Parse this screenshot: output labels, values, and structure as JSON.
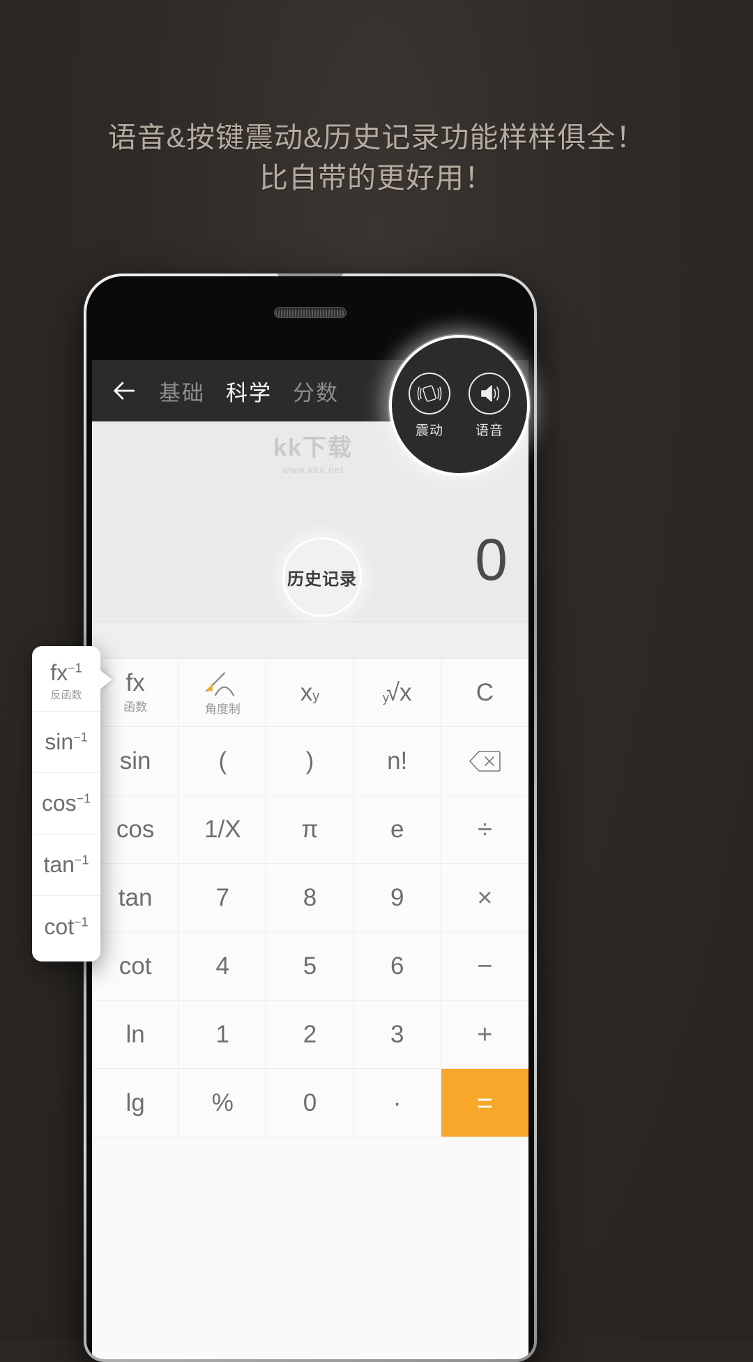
{
  "headline": {
    "line1": "语音&按键震动&历史记录功能样样俱全！",
    "line2": "比自带的更好用！"
  },
  "app": {
    "appbar": {
      "back_icon": "back-arrow-icon",
      "tabs": [
        {
          "label": "基础",
          "active": false
        },
        {
          "label": "科学",
          "active": true
        },
        {
          "label": "分数",
          "active": false
        }
      ]
    },
    "display": {
      "value": "0",
      "watermark_main": "kk下载",
      "watermark_sub": "www.kkx.net"
    },
    "keypad": {
      "rows": [
        [
          {
            "main": "fx",
            "sub": "函数",
            "type": "func"
          },
          {
            "main": "",
            "sub": "角度制",
            "type": "angle-icon"
          },
          {
            "main": "x",
            "sup": "y",
            "type": "power"
          },
          {
            "main": "√x",
            "idx": "y",
            "type": "root"
          },
          {
            "main": "C",
            "type": "clear"
          }
        ],
        [
          {
            "main": "sin",
            "type": "func"
          },
          {
            "main": "(",
            "type": "paren"
          },
          {
            "main": ")",
            "type": "paren"
          },
          {
            "main": "n!",
            "type": "func"
          },
          {
            "main": "",
            "type": "backspace-icon"
          }
        ],
        [
          {
            "main": "cos",
            "type": "func"
          },
          {
            "main": "1/X",
            "type": "func"
          },
          {
            "main": "π",
            "type": "const"
          },
          {
            "main": "e",
            "type": "const"
          },
          {
            "main": "÷",
            "type": "op"
          }
        ],
        [
          {
            "main": "tan",
            "type": "func"
          },
          {
            "main": "7",
            "type": "digit"
          },
          {
            "main": "8",
            "type": "digit"
          },
          {
            "main": "9",
            "type": "digit"
          },
          {
            "main": "×",
            "type": "op"
          }
        ],
        [
          {
            "main": "cot",
            "type": "func"
          },
          {
            "main": "4",
            "type": "digit"
          },
          {
            "main": "5",
            "type": "digit"
          },
          {
            "main": "6",
            "type": "digit"
          },
          {
            "main": "−",
            "type": "op"
          }
        ],
        [
          {
            "main": "ln",
            "type": "func"
          },
          {
            "main": "1",
            "type": "digit"
          },
          {
            "main": "2",
            "type": "digit"
          },
          {
            "main": "3",
            "type": "digit"
          },
          {
            "main": "+",
            "type": "op"
          }
        ],
        [
          {
            "main": "lg",
            "type": "func"
          },
          {
            "main": "%",
            "type": "func"
          },
          {
            "main": "0",
            "type": "digit"
          },
          {
            "main": "·",
            "type": "digit"
          },
          {
            "main": "=",
            "type": "equals"
          }
        ]
      ]
    }
  },
  "magnifier_top": {
    "items": [
      {
        "icon": "vibration-icon",
        "label": "震动"
      },
      {
        "icon": "speaker-icon",
        "label": "语音"
      }
    ]
  },
  "magnifier_history": {
    "label": "历史记录"
  },
  "inverse_panel": {
    "items": [
      {
        "main": "fx",
        "sup": "−1",
        "sub": "反函数"
      },
      {
        "main": "sin",
        "sup": "−1",
        "sub": ""
      },
      {
        "main": "cos",
        "sup": "−1",
        "sub": ""
      },
      {
        "main": "tan",
        "sup": "−1",
        "sub": ""
      },
      {
        "main": "cot",
        "sup": "−1",
        "sub": ""
      }
    ]
  },
  "colors": {
    "background": "#2b2724",
    "headline_text": "#b6aba0",
    "appbar": "#2b2b2b",
    "accent_orange": "#f7a72a",
    "display_bg": "#eaeaea",
    "key_text": "#6e6e6e"
  }
}
